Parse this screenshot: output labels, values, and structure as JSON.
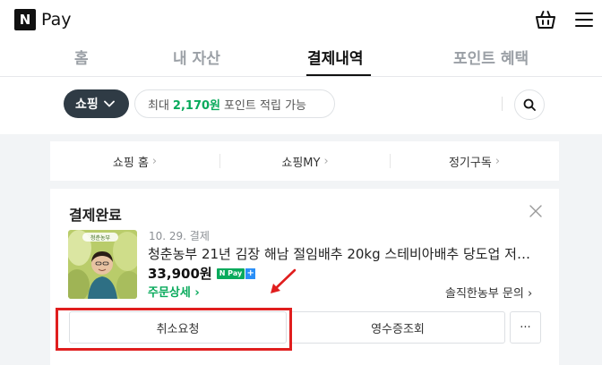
{
  "header": {
    "logo_letter": "N",
    "logo_text": "Pay"
  },
  "tabs": [
    {
      "label": "홈",
      "active": false
    },
    {
      "label": "내 자산",
      "active": false
    },
    {
      "label": "결제내역",
      "active": true
    },
    {
      "label": "포인트 혜택",
      "active": false
    }
  ],
  "filter": {
    "category_label": "쇼핑",
    "points_prefix": "최대",
    "points_amount": "2,170원",
    "points_suffix": "포인트 적립 가능"
  },
  "nav_links": [
    {
      "label": "쇼핑 홈"
    },
    {
      "label": "쇼핑MY"
    },
    {
      "label": "정기구독"
    }
  ],
  "order": {
    "status": "결제완료",
    "date": "10. 29. 결제",
    "product_name": "청춘농부 21년 김장 해남 절임배추 20kg 스테비아배추 당도업 저장…",
    "price": "33,900원",
    "npay_badge": "N Pay",
    "order_detail_link": "주문상세",
    "seller_inquiry": "솔직한농부 문의",
    "thumb_caption": "청춘농부",
    "buttons": {
      "cancel": "취소요청",
      "receipt": "영수증조회",
      "more": "···"
    }
  },
  "colors": {
    "accent_green": "#09aa5c",
    "highlight_red": "#e01e1e",
    "dark_button": "#2f3b45"
  },
  "icons": [
    "cart-icon",
    "hamburger-menu-icon",
    "chevron-down-icon",
    "search-icon",
    "close-icon",
    "chevron-right-icon"
  ]
}
